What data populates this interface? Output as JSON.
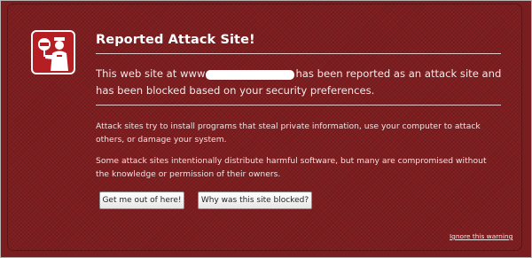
{
  "warning": {
    "title": "Reported Attack Site!",
    "lead_before": "This web site at www",
    "lead_after": "has been reported as an attack site and has been blocked based on your security preferences.",
    "paragraph_1": "Attack sites try to install programs that steal private information, use your computer to attack others, or damage your system.",
    "paragraph_2": "Some attack sites intentionally distribute harmful software, but many are compromised without the knowledge or permission of their owners.",
    "button_escape": "Get me out of here!",
    "button_why": "Why was this site blocked?",
    "ignore_link": "Ignore this warning"
  },
  "colors": {
    "background": "#7d1c1e",
    "icon_red": "#b51f24",
    "text": "#ffffff"
  },
  "icons": {
    "badge": "police-officer-stop-icon"
  }
}
